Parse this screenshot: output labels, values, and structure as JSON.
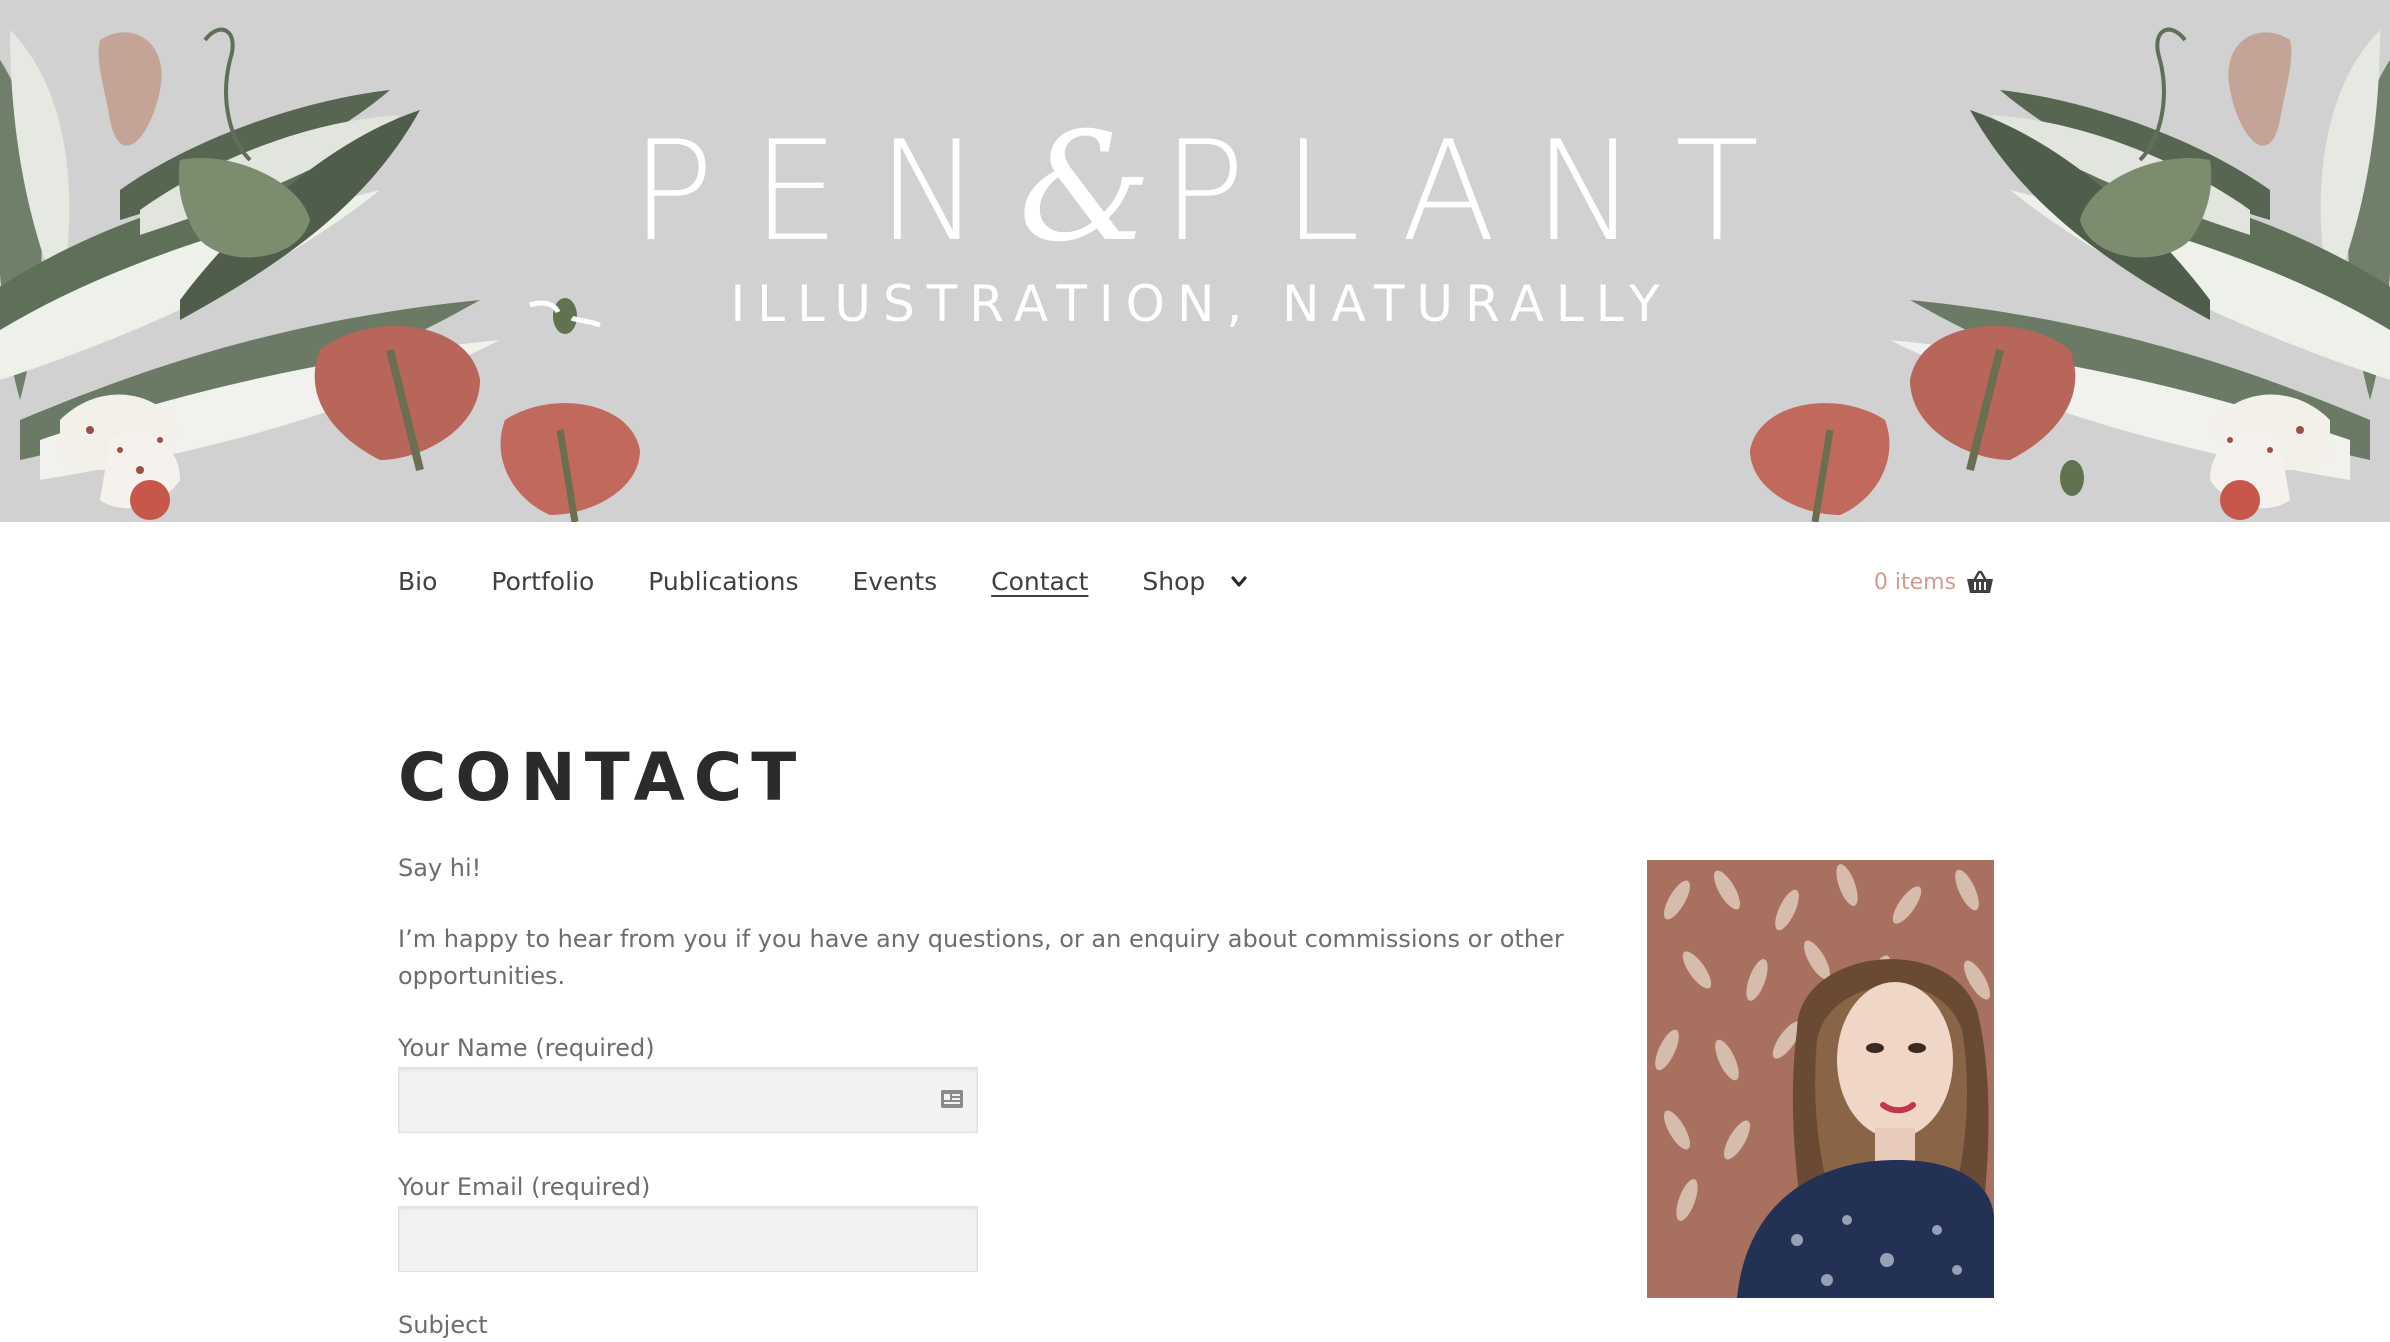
{
  "header": {
    "title_part1": "PEN",
    "ampersand": "&",
    "title_part2": "PLANT",
    "tagline": "ILLUSTRATION, NATURALLY",
    "background_color": "#d0d1d0"
  },
  "nav": {
    "items": [
      {
        "label": "Bio"
      },
      {
        "label": "Portfolio"
      },
      {
        "label": "Publications"
      },
      {
        "label": "Events"
      },
      {
        "label": "Contact",
        "current": true
      },
      {
        "label": "Shop",
        "has_submenu": true
      }
    ],
    "submenu_icon": "chevron-down-icon"
  },
  "cart": {
    "count_label": "0 items",
    "icon": "basket-icon",
    "accent_color": "#d89a8b"
  },
  "page": {
    "title": "CONTACT",
    "intro": "Say hi!",
    "body": "I’m happy to hear from you if you have any questions, or an enquiry about commissions or other opportunities."
  },
  "form": {
    "name_label": "Your Name (required)",
    "name_value": "",
    "name_autofill_icon": "contact-card-icon",
    "email_label": "Your Email (required)",
    "email_value": "",
    "subject_label": "Subject"
  },
  "portrait": {
    "image": "artist-portrait-photo"
  }
}
